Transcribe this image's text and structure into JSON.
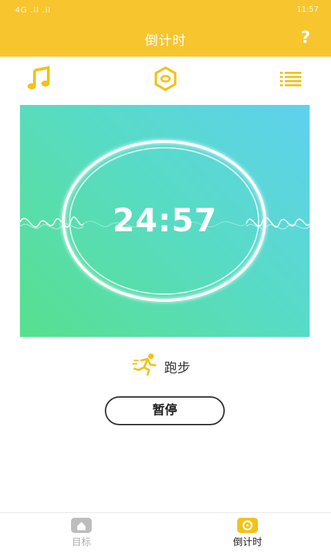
{
  "status_bar": {
    "left": "4G .il .il",
    "right": "11:57"
  },
  "header": {
    "title": "倒计时",
    "help_label": "?"
  },
  "toolbar": {
    "music_icon": "music-note-icon",
    "target_icon": "hexagon-target-icon",
    "list_icon": "list-icon"
  },
  "timer": {
    "time": "24:57"
  },
  "activity": {
    "icon": "running-icon",
    "label": "跑步"
  },
  "controls": {
    "pause_label": "暂停"
  },
  "bottom_nav": {
    "items": [
      {
        "label": "目标",
        "icon": "home-icon",
        "active": false
      },
      {
        "label": "倒计时",
        "icon": "timer-icon",
        "active": true
      }
    ]
  },
  "colors": {
    "accent": "#f7c52e",
    "gradient_start": "#57e08e",
    "gradient_end": "#5fd1ef"
  }
}
